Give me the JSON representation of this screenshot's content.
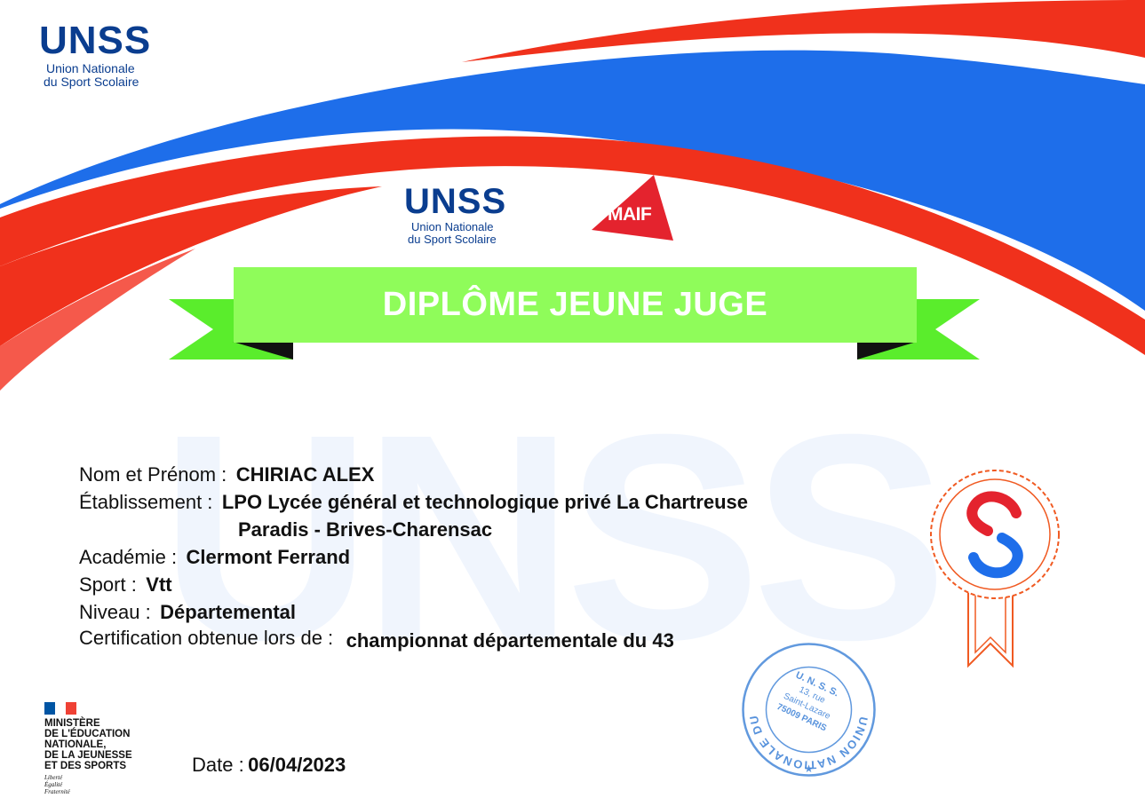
{
  "colors": {
    "blue": "#1e6eea",
    "red": "#f0311c",
    "green": "#8ffc5a",
    "navy": "#0a3d8f",
    "maif_red": "#e4232e",
    "stamp_blue": "#3a7fd6",
    "rosette_orange": "#f05a22"
  },
  "header": {
    "logo_main": {
      "wordmark": "UNSS",
      "line1": "Union Nationale",
      "line2": "du Sport Scolaire"
    },
    "logo_center": {
      "wordmark": "UNSS",
      "line1": "Union Nationale",
      "line2": "du Sport Scolaire"
    },
    "partner_logo": "MAIF"
  },
  "banner": {
    "title": "DIPLÔME JEUNE JUGE"
  },
  "watermark": "UNSS",
  "fields": {
    "name": {
      "label": "Nom et Prénom :",
      "value": "CHIRIAC ALEX"
    },
    "school": {
      "label": "Établissement :",
      "value_line1": "LPO Lycée général et technologique privé La Chartreuse",
      "value_line2": "Paradis - Brives-Charensac"
    },
    "academy": {
      "label": "Académie :",
      "value": "Clermont Ferrand"
    },
    "sport": {
      "label": "Sport :",
      "value": "Vtt"
    },
    "level": {
      "label": "Niveau :",
      "value": "Départemental"
    },
    "certification": {
      "label": "Certification obtenue lors de :",
      "value": "championnat départementale du 43"
    }
  },
  "ministry": {
    "lines": [
      "MINISTÈRE",
      "DE L'ÉDUCATION",
      "NATIONALE,",
      "DE LA JEUNESSE",
      "ET DES SPORTS"
    ],
    "motto": [
      "Liberté",
      "Égalité",
      "Fraternité"
    ]
  },
  "date": {
    "label": "Date :",
    "value": "06/04/2023"
  },
  "stamp": {
    "ring_text": "UNION NATIONALE DU SPORT SCOLAIRE",
    "center": [
      "U. N. S. S.",
      "13, rue",
      "Saint-Lazare",
      "75009 PARIS"
    ]
  },
  "icons": [
    "unss-logo-icon",
    "maif-logo-icon",
    "rosette-seal-icon",
    "stamp-icon",
    "marianne-flag-icon"
  ]
}
